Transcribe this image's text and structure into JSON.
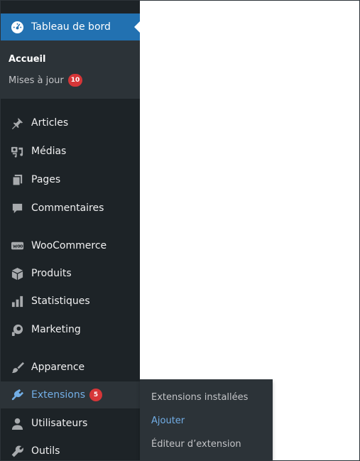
{
  "sidebar": {
    "dashboard": {
      "label": "Tableau de bord",
      "icon": "dashboard-gauge-icon"
    },
    "dashboard_submenu": {
      "home": "Accueil",
      "updates": "Mises à jour",
      "updates_count": "10"
    },
    "items": [
      {
        "label": "Articles",
        "icon": "pushpin-icon"
      },
      {
        "label": "Médias",
        "icon": "media-icon"
      },
      {
        "label": "Pages",
        "icon": "pages-icon"
      },
      {
        "label": "Commentaires",
        "icon": "comment-icon"
      },
      {
        "label": "WooCommerce",
        "icon": "woocommerce-icon"
      },
      {
        "label": "Produits",
        "icon": "box-icon"
      },
      {
        "label": "Statistiques",
        "icon": "bar-chart-icon"
      },
      {
        "label": "Marketing",
        "icon": "megaphone-icon"
      },
      {
        "label": "Apparence",
        "icon": "paintbrush-icon"
      },
      {
        "label": "Extensions",
        "icon": "plugin-icon",
        "badge": "5"
      },
      {
        "label": "Utilisateurs",
        "icon": "user-icon"
      },
      {
        "label": "Outils",
        "icon": "wrench-icon"
      }
    ]
  },
  "flyout": {
    "installed": "Extensions installées",
    "add": "Ajouter",
    "editor": "Éditeur d’extension"
  },
  "colors": {
    "sidebar_bg": "#1d2327",
    "submenu_bg": "#2c3338",
    "active_bg": "#2271b1",
    "accent_link": "#72aee6",
    "badge": "#d63638"
  }
}
